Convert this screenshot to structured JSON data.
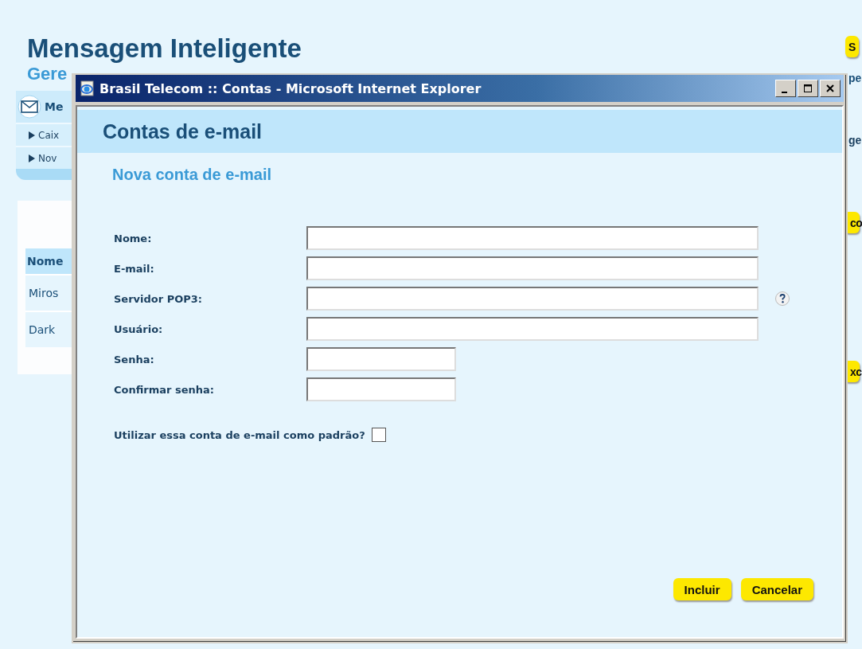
{
  "page": {
    "title": "Mensagem Inteligente",
    "subtitle": "Gere",
    "menu": {
      "heading": "Me",
      "items": [
        "Caix",
        "Nov"
      ]
    },
    "table": {
      "header": "Nome",
      "rows": [
        "Miros",
        "Dark"
      ]
    },
    "right_edge": {
      "top_button": "S",
      "texts": [
        "pe",
        "ge"
      ],
      "buttons": [
        "co",
        "xc"
      ]
    }
  },
  "popup": {
    "title": "Brasil Telecom :: Contas - Microsoft Internet Explorer",
    "header": "Contas de e-mail",
    "subheading": "Nova conta de e-mail",
    "fields": [
      {
        "label": "Nome:",
        "kind": "long",
        "help": false
      },
      {
        "label": "E-mail:",
        "kind": "long",
        "help": false
      },
      {
        "label": "Servidor POP3:",
        "kind": "long",
        "help": true
      },
      {
        "label": "Usuário:",
        "kind": "long",
        "help": false
      },
      {
        "label": "Senha:",
        "kind": "short",
        "help": false
      },
      {
        "label": "Confirmar senha:",
        "kind": "short",
        "help": false
      }
    ],
    "default_question": "Utilizar essa conta de e-mail como padrão?",
    "default_checked": false,
    "buttons": [
      "Incluir",
      "Cancelar"
    ]
  }
}
